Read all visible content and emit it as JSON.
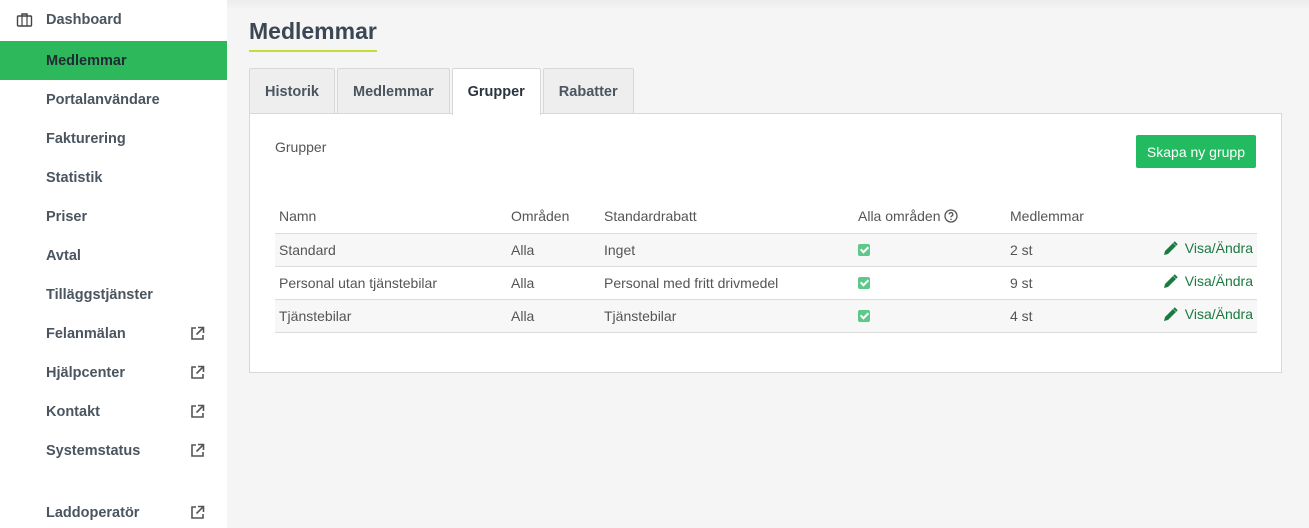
{
  "sidebar": {
    "items": [
      {
        "label": "Dashboard",
        "icon": "briefcase-icon",
        "external": false,
        "active": false
      },
      {
        "label": "Medlemmar",
        "external": false,
        "active": true
      },
      {
        "label": "Portalanvändare",
        "external": false,
        "active": false
      },
      {
        "label": "Fakturering",
        "external": false,
        "active": false
      },
      {
        "label": "Statistik",
        "external": false,
        "active": false
      },
      {
        "label": "Priser",
        "external": false,
        "active": false
      },
      {
        "label": "Avtal",
        "external": false,
        "active": false
      },
      {
        "label": "Tilläggstjänster",
        "external": false,
        "active": false
      },
      {
        "label": "Felanmälan",
        "external": true,
        "active": false
      },
      {
        "label": "Hjälpcenter",
        "external": true,
        "active": false
      },
      {
        "label": "Kontakt",
        "external": true,
        "active": false
      },
      {
        "label": "Systemstatus",
        "external": true,
        "active": false
      },
      {
        "label": "Laddoperatör",
        "external": true,
        "active": false
      }
    ]
  },
  "page": {
    "title": "Medlemmar"
  },
  "tabs": [
    {
      "label": "Historik",
      "active": false
    },
    {
      "label": "Medlemmar",
      "active": false
    },
    {
      "label": "Grupper",
      "active": true
    },
    {
      "label": "Rabatter",
      "active": false
    }
  ],
  "panel": {
    "heading": "Grupper",
    "create_button": "Skapa ny grupp",
    "columns": {
      "name": "Namn",
      "areas": "Områden",
      "discount": "Standardrabatt",
      "all_areas": "Alla områden",
      "members": "Medlemmar"
    },
    "rows": [
      {
        "name": "Standard",
        "areas": "Alla",
        "discount": "Inget",
        "all_areas": true,
        "members": "2 st",
        "action": "Visa/Ändra"
      },
      {
        "name": "Personal utan tjänstebilar",
        "areas": "Alla",
        "discount": "Personal med fritt drivmedel",
        "all_areas": true,
        "members": "9 st",
        "action": "Visa/Ändra"
      },
      {
        "name": "Tjänstebilar",
        "areas": "Alla",
        "discount": "Tjänstebilar",
        "all_areas": true,
        "members": "4 st",
        "action": "Visa/Ändra"
      }
    ]
  },
  "colors": {
    "accent": "#2db85c",
    "button": "#23bb5f",
    "title_underline": "#c7dc3c",
    "link": "#1a7a3f"
  }
}
